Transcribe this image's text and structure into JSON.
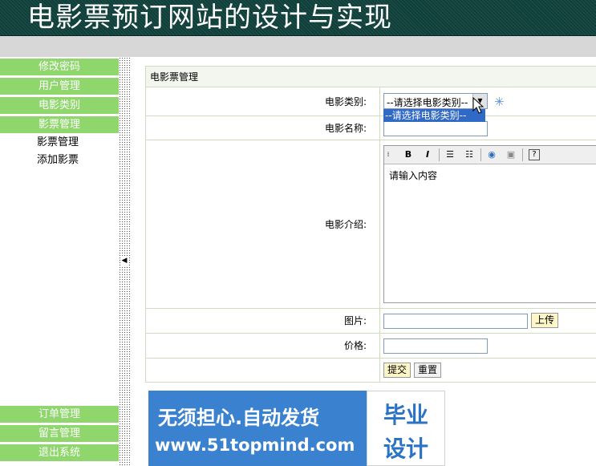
{
  "header": {
    "title": "电影票预订网站的设计与实现"
  },
  "sidebar": {
    "top_items": [
      "修改密码",
      "用户管理",
      "电影类别",
      "影票管理"
    ],
    "sub_items": [
      "影票管理",
      "添加影票"
    ],
    "bottom_items": [
      "订单管理",
      "留言管理",
      "退出系统"
    ]
  },
  "form": {
    "panel_title": "电影票管理",
    "labels": {
      "category": "电影类别:",
      "name": "电影名称:",
      "intro": "电影介绍:",
      "image": "图片:",
      "price": "价格:"
    },
    "category_select": {
      "selected": "--请选择电影类别--",
      "options": [
        "--请选择电影类别--"
      ]
    },
    "editor": {
      "content": "请输入内容",
      "toolbar_icons": [
        "bold-icon",
        "italic-icon",
        "ordered-list-icon",
        "unordered-list-icon",
        "link-icon",
        "image-icon",
        "help-icon"
      ]
    },
    "buttons": {
      "upload": "上传",
      "submit": "提交",
      "reset": "重置"
    }
  },
  "banner": {
    "slogan": "无须担心.自动发货",
    "url": "www.51topmind.com",
    "tag_line1": "毕业",
    "tag_line2": "设计"
  },
  "colors": {
    "header_bg": "#0f3f3a",
    "menu_bg": "#8fd66d",
    "selection": "#3169c6",
    "button_bg": "#fdf7c7"
  }
}
